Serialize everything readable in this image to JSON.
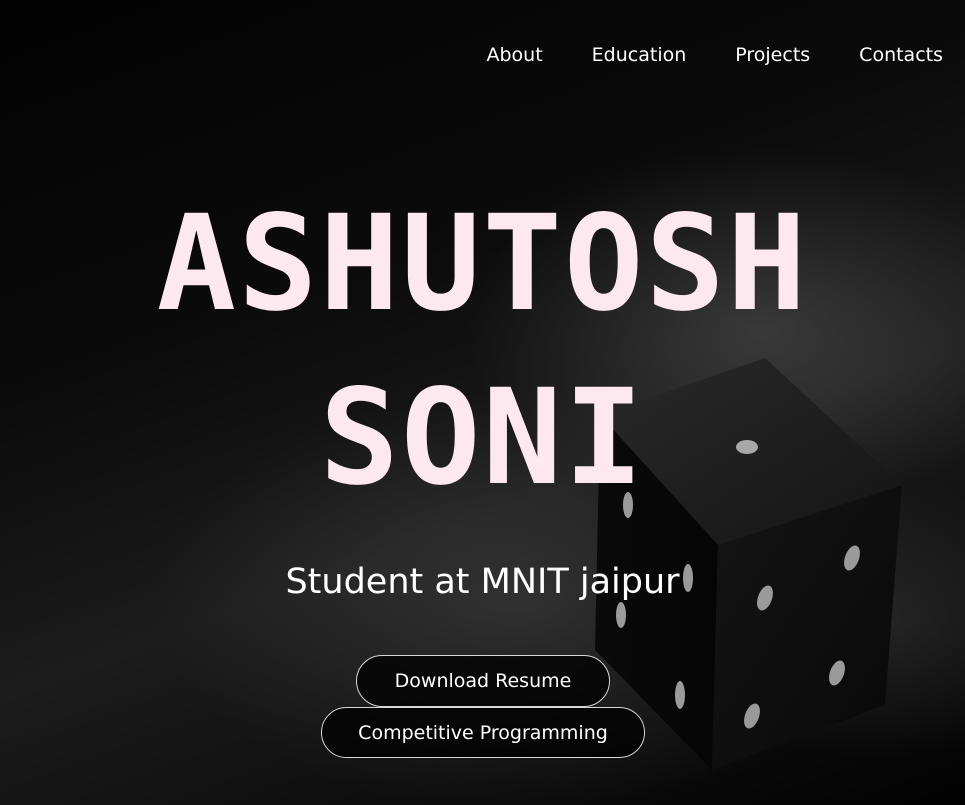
{
  "nav": {
    "items": [
      {
        "label": "About"
      },
      {
        "label": "Education"
      },
      {
        "label": "Projects"
      },
      {
        "label": "Contacts"
      }
    ]
  },
  "hero": {
    "name_line1": "ASHUTOSH",
    "name_line2": "SONI",
    "subtitle": "Student at MNIT jaipur",
    "buttons": {
      "resume_label": "Download Resume",
      "cp_label": "Competitive Programming"
    }
  },
  "background": {
    "image_subject": "dice-image",
    "title_color": "#fde8f0"
  }
}
